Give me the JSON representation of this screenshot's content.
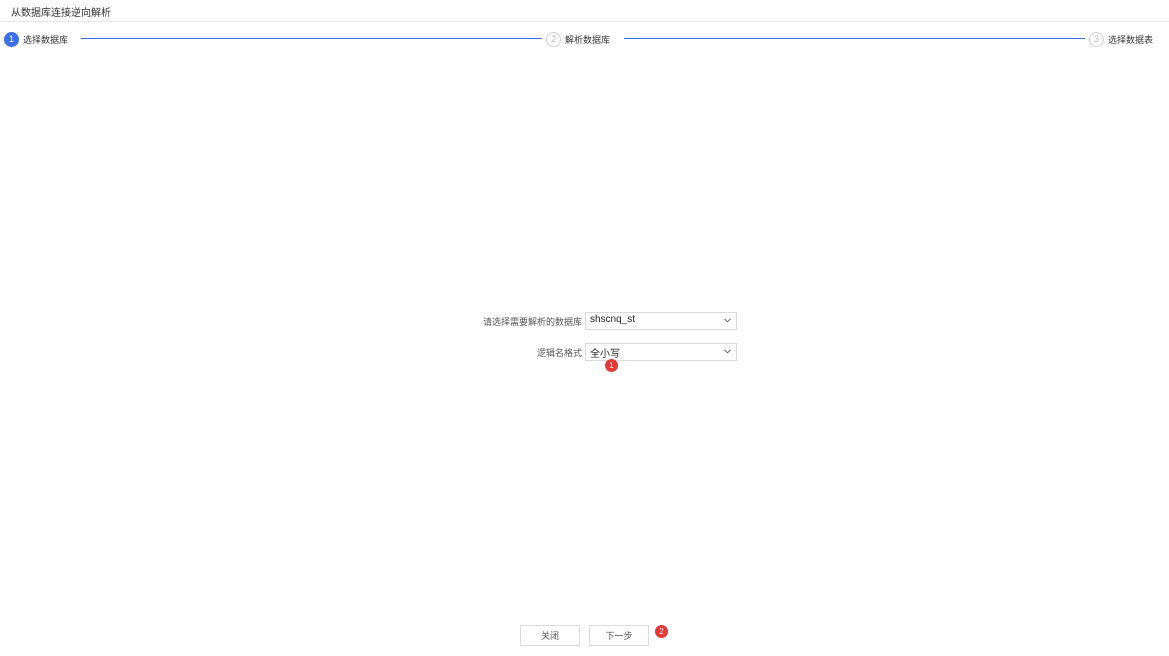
{
  "header": {
    "title": "从数据库连接逆向解析"
  },
  "steps": [
    {
      "number": "1",
      "label": "选择数据库",
      "state": "active"
    },
    {
      "number": "2",
      "label": "解析数据库",
      "state": "inactive"
    },
    {
      "number": "3",
      "label": "选择数据表",
      "state": "inactive"
    }
  ],
  "form": {
    "database": {
      "label": "请选择需要解析的数据库",
      "value": "shscnq_st"
    },
    "logical_name_format": {
      "label": "逻辑名格式",
      "value": "全小写"
    }
  },
  "annotations": {
    "badge_1": "1",
    "badge_2": "2"
  },
  "buttons": {
    "close_label": "关闭",
    "next_label": "下一步"
  },
  "colors": {
    "accent": "#3d6fe6",
    "badge": "#e53935",
    "border": "#d9d9d9"
  },
  "icons": {
    "dropdown": "chevron-down-icon"
  }
}
